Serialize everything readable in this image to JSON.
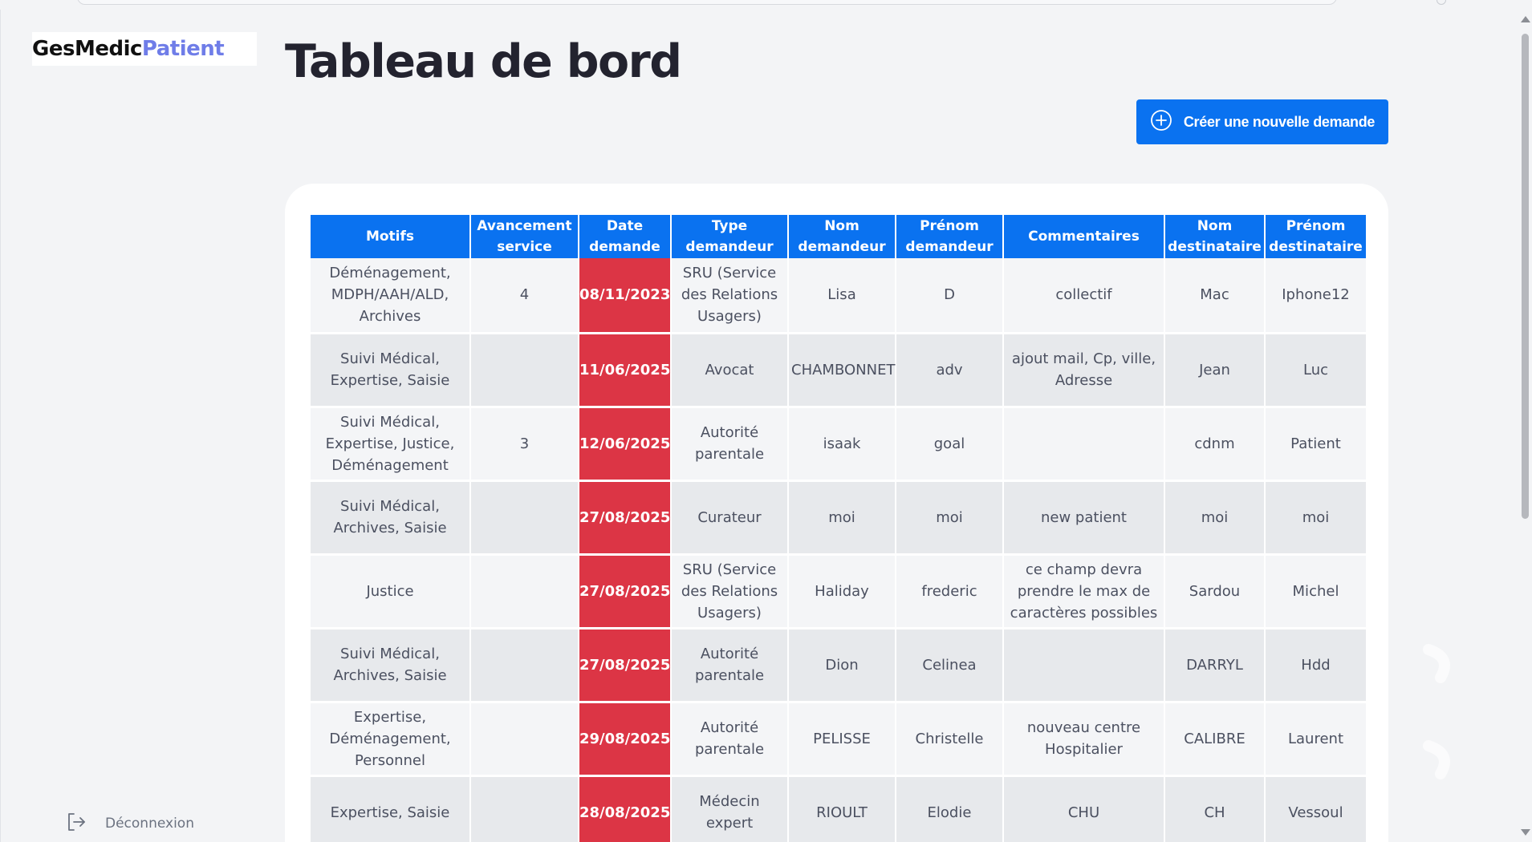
{
  "brand": {
    "part1": "GesMedic",
    "part2": "Patient"
  },
  "sidebar": {
    "logout_label": "Déconnexion"
  },
  "page": {
    "title": "Tableau de bord"
  },
  "actions": {
    "create_label": "Créer une nouvelle demande"
  },
  "colors": {
    "primary": "#0a72f0",
    "date_cell": "#dc3545",
    "brand_accent": "#6f7de8"
  },
  "table": {
    "headers": [
      "Motifs",
      "Avancement service",
      "Date demande",
      "Type demandeur",
      "Nom demandeur",
      "Prénom demandeur",
      "Commentaires",
      "Nom destinataire",
      "Prénom destinataire"
    ],
    "rows": [
      [
        "Déménagement, MDPH/AAH/ALD, Archives",
        "4",
        "08/11/2023",
        "SRU (Service des Relations Usagers)",
        "Lisa",
        "D",
        "collectif",
        "Mac",
        "Iphone12"
      ],
      [
        "Suivi Médical, Expertise, Saisie",
        "",
        "11/06/2025",
        "Avocat",
        "CHAMBONNET",
        "adv",
        "ajout mail, Cp, ville, Adresse",
        "Jean",
        "Luc"
      ],
      [
        "Suivi Médical, Expertise, Justice, Déménagement",
        "3",
        "12/06/2025",
        "Autorité parentale",
        "isaak",
        "goal",
        "",
        "cdnm",
        "Patient"
      ],
      [
        "Suivi Médical, Archives, Saisie",
        "",
        "27/08/2025",
        "Curateur",
        "moi",
        "moi",
        "new patient",
        "moi",
        "moi"
      ],
      [
        "Justice",
        "",
        "27/08/2025",
        "SRU (Service des Relations Usagers)",
        "Haliday",
        "frederic",
        "ce champ devra prendre le max de caractères possibles",
        "Sardou",
        "Michel"
      ],
      [
        "Suivi Médical, Archives, Saisie",
        "",
        "27/08/2025",
        "Autorité parentale",
        "Dion",
        "Celinea",
        "",
        "DARRYL",
        "Hdd"
      ],
      [
        "Expertise, Déménagement, Personnel",
        "",
        "29/08/2025",
        "Autorité parentale",
        "PELISSE",
        "Christelle",
        "nouveau centre Hospitalier",
        "CALIBRE",
        "Laurent"
      ],
      [
        "Expertise, Saisie",
        "",
        "28/08/2025",
        "Médecin expert",
        "RIOULT",
        "Elodie",
        "CHU",
        "CH",
        "Vessoul"
      ]
    ]
  }
}
